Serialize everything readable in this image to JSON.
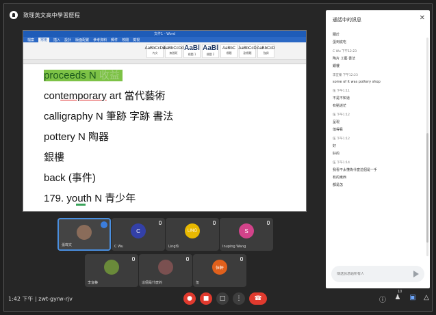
{
  "window": {
    "title": "致理英文高中學習歷程"
  },
  "document": {
    "title_bar": "文件1 - Word",
    "tabs": [
      "檔案",
      "常用",
      "插入",
      "設計",
      "版面配置",
      "參考資料",
      "郵件",
      "校閱",
      "檢視"
    ],
    "styles": [
      {
        "sample": "AaBbCcDd",
        "name": "內文"
      },
      {
        "sample": "AaBbCcDd",
        "name": "無間距"
      },
      {
        "sample": "AaBl",
        "name": "標題 1"
      },
      {
        "sample": "AaBl",
        "name": "標題 2"
      },
      {
        "sample": "AaBbC",
        "name": "標題"
      },
      {
        "sample": "AaBbCcD",
        "name": "副標題"
      },
      {
        "sample": "AaBbCcD",
        "name": "強調"
      }
    ],
    "lines": [
      {
        "pre": "proceeds N",
        "faint": "收益"
      },
      {
        "bold": "con",
        "underlined": "temporary",
        "rest": " art  當代藝術"
      },
      {
        "text": "calligraphy N 筆跡  字跡  書法"
      },
      {
        "text": "pottery N 陶器"
      },
      {
        "text": "銀樓"
      },
      {
        "text": "back (事件)"
      },
      {
        "text": "179. youth N 青少年"
      }
    ]
  },
  "participants": [
    {
      "name": "張瑋文",
      "avatar": "",
      "color": "#8a6c5a",
      "active": true
    },
    {
      "name": "C Wu",
      "avatar": "C",
      "color": "#3340a8",
      "active": false
    },
    {
      "name": "Ling玲",
      "avatar": "LING",
      "color": "#e8b800",
      "active": false
    },
    {
      "name": "Inuping Wang",
      "avatar": "S",
      "color": "#d2438a",
      "active": false
    },
    {
      "name": "李宜蓁",
      "avatar": "",
      "color": "#6a8a3a",
      "active": false
    },
    {
      "name": "這個是什麼的",
      "avatar": "",
      "color": "#7a5050",
      "active": false
    },
    {
      "name": "伍",
      "avatar": "伍軒",
      "color": "#e0601c",
      "active": false
    }
  ],
  "bottom_bar": {
    "time_meeting": "1:42 下午  |  zwt-gyrw-rjv",
    "people_count": "10"
  },
  "chat": {
    "title": "通話中的訊息",
    "input_placeholder": "傳送訊息給所有人",
    "messages": [
      {
        "sender": "",
        "text": "關於"
      },
      {
        "sender": "",
        "text": "蛋到底吃"
      },
      {
        "sender": "C Wu  下午12:23",
        "text": "陶片 工藝 書法"
      },
      {
        "sender": "",
        "text": "銀樓"
      },
      {
        "sender": "李宜蓁  下午12:23",
        "text": "some of it was pottery shop"
      },
      {
        "sender": "伍  下午1:11",
        "text": "不是不知道"
      },
      {
        "sender": "",
        "text": "有點迷茫"
      },
      {
        "sender": "伍  下午1:12",
        "text": "呈現"
      },
      {
        "sender": "",
        "text": "值得看"
      },
      {
        "sender": "伍  下午1:12",
        "text": "好"
      },
      {
        "sender": "",
        "text": "好的"
      },
      {
        "sender": "伍  下午1:14",
        "text": "我看不太懂為什麼這個是一手"
      },
      {
        "sender": "",
        "text": "有的東西"
      },
      {
        "sender": "",
        "text": "都是怎"
      }
    ]
  },
  "colors": {
    "accent": "#1a73e8",
    "hangup": "#e03a2e",
    "highlight": "#7dc246"
  }
}
